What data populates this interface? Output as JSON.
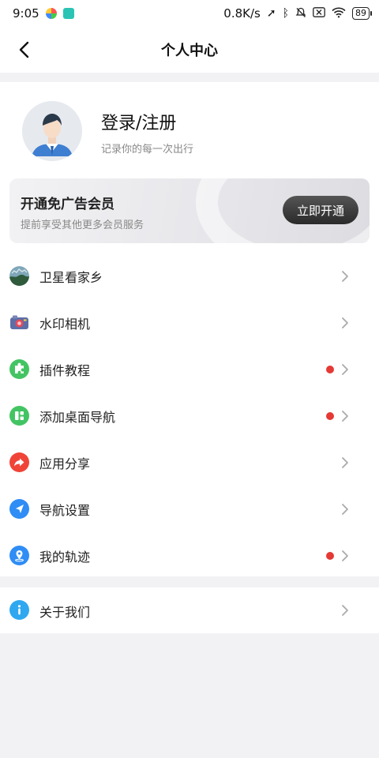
{
  "status_bar": {
    "time": "9:05",
    "net_speed": "0.8K/s",
    "battery": "89",
    "icons": [
      "app-icon-colorful",
      "app-icon-send",
      "location-arrow-icon",
      "bluetooth-icon",
      "mute-bell-icon",
      "sim-x-icon",
      "wifi-icon"
    ]
  },
  "header": {
    "title": "个人中心",
    "back_icon": "chevron-left-icon"
  },
  "profile": {
    "login_label": "登录/注册",
    "subtitle": "记录你的每一次出行",
    "avatar_icon": "avatar-man-icon"
  },
  "vip": {
    "title": "开通免广告会员",
    "subtitle": "提前享受其他更多会员服务",
    "button_label": "立即开通"
  },
  "menu": {
    "items": [
      {
        "label": "卫星看家乡",
        "icon": "satellite-photo-icon",
        "dot": false
      },
      {
        "label": "水印相机",
        "icon": "camera-icon",
        "dot": false
      },
      {
        "label": "插件教程",
        "icon": "puzzle-icon",
        "dot": true
      },
      {
        "label": "添加桌面导航",
        "icon": "grid-icon",
        "dot": true
      },
      {
        "label": "应用分享",
        "icon": "share-icon",
        "dot": false
      },
      {
        "label": "导航设置",
        "icon": "navigation-icon",
        "dot": false
      },
      {
        "label": "我的轨迹",
        "icon": "location-pin-icon",
        "dot": true
      }
    ]
  },
  "about": {
    "label": "关于我们",
    "icon": "info-icon"
  },
  "colors": {
    "accent_red": "#e53935",
    "icon_green": "#43c463",
    "icon_red": "#f04438",
    "icon_blue": "#2f8df5",
    "background": "#f2f2f5"
  }
}
